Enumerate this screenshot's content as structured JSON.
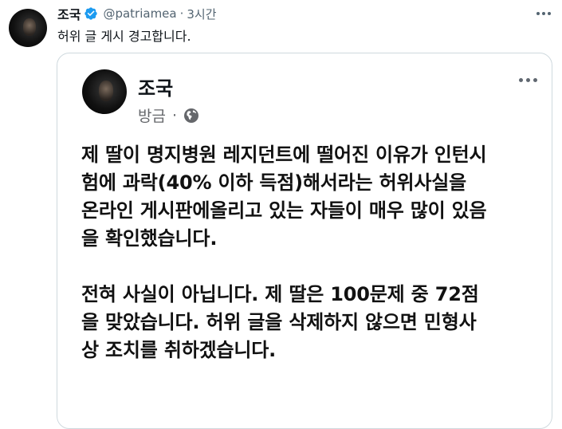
{
  "tweet": {
    "author_name": "조국",
    "handle": "@patriamea",
    "separator": "·",
    "time": "3시간",
    "text": "허위 글 게시 경고합니다."
  },
  "card": {
    "author_name": "조국",
    "time": "방금",
    "separator": "·",
    "paragraph1": [
      "제 딸이 명지병원 레지던트에 떨어진 이유가 인턴시",
      "험에 과락(40% 이하 득점)해서라는 허위사실을",
      "온라인 게시판에올리고 있는 자들이 매우 많이 있음",
      "을 확인했습니다."
    ],
    "paragraph2": [
      "전혀 사실이 아닙니다. 제 딸은 100문제 중 72점",
      "을 맞았습니다. 허위 글을 삭제하지 않으면 민형사",
      "상 조치를 취하겠습니다."
    ]
  },
  "icons": {
    "verified": "verified-badge-icon",
    "more": "more-icon",
    "globe": "globe-icon"
  },
  "colors": {
    "verified": "#1d9bf0",
    "secondary_text": "#536471",
    "border": "#cfd9de"
  }
}
